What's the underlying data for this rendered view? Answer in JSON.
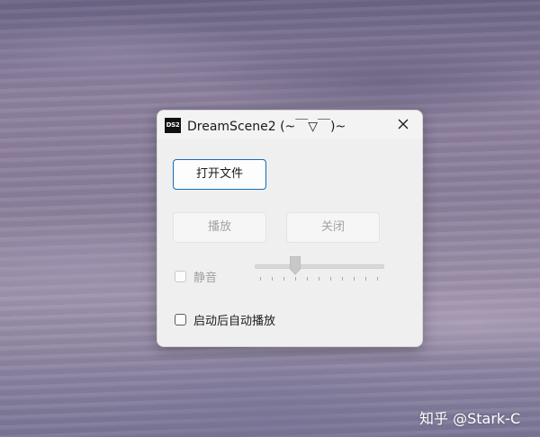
{
  "window": {
    "icon_text": "DS2",
    "title": "DreamScene2 (~￣▽￣)~"
  },
  "buttons": {
    "open_file": "打开文件",
    "play": "播放",
    "close": "关闭"
  },
  "mute": {
    "label": "静音",
    "checked": false,
    "disabled": true
  },
  "volume_slider": {
    "value_fraction": 0.3,
    "tick_count": 11,
    "disabled": true
  },
  "autoplay": {
    "label": "启动后自动播放",
    "checked": false
  },
  "watermark": "知乎 @Stark-C",
  "colors": {
    "accent": "#0f6cbd",
    "disabled_text": "#a2a2a2"
  }
}
